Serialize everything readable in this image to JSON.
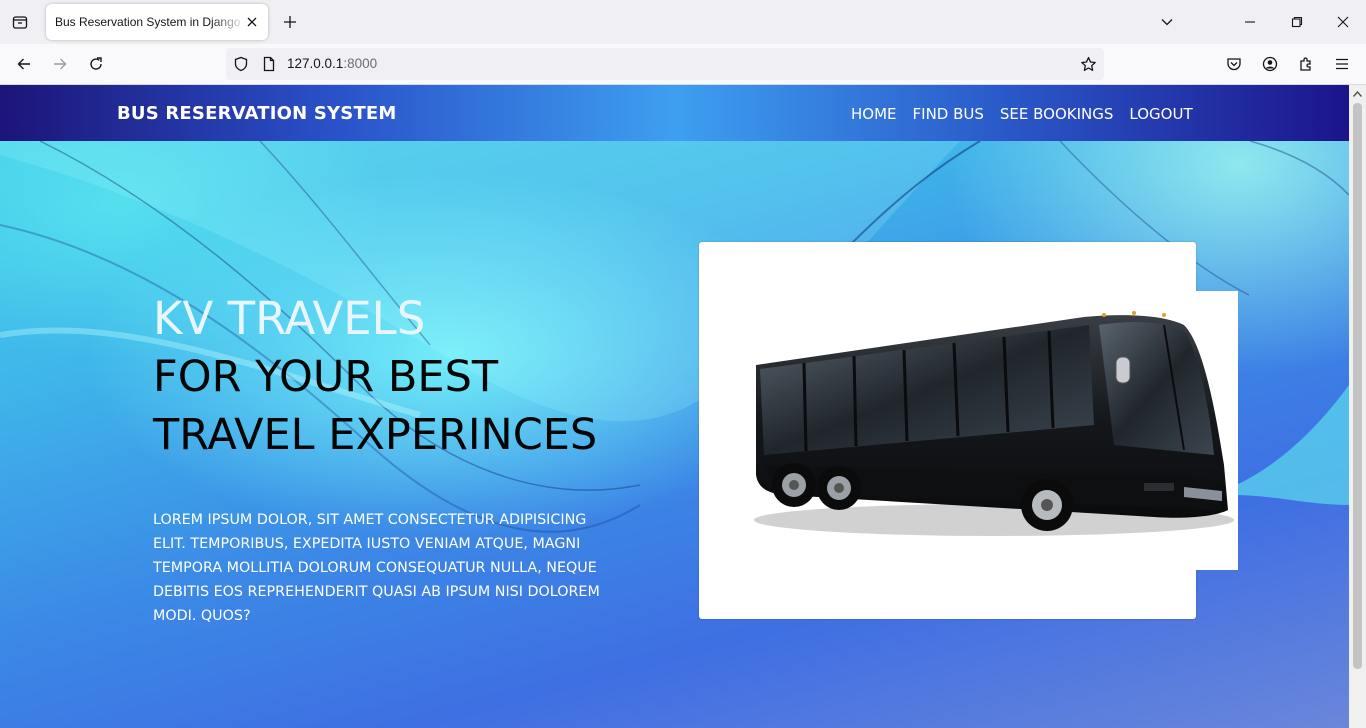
{
  "browser": {
    "tab_title": "Bus Reservation System in Django Framework",
    "url_host": "127.0.0.1",
    "url_port": ":8000"
  },
  "site": {
    "brand": "BUS RESERVATION SYSTEM",
    "nav": [
      "HOME",
      "FIND BUS",
      "SEE BOOKINGS",
      "LOGOUT"
    ]
  },
  "hero": {
    "line1": "KV TRAVELS",
    "line2": "FOR YOUR BEST",
    "line3": "TRAVEL EXPERINCES",
    "description": "Lorem ipsum dolor, sit amet consectetur adipisicing elit. Temporibus, expedita iusto veniam atque, magni tempora mollitia dolorum consequatur nulla, neque debitis eos reprehenderit quasi ab ipsum nisi dolorem modi. Quos?"
  },
  "colors": {
    "header_accent": "#3e9ff0",
    "header_dark": "#1c1478"
  }
}
